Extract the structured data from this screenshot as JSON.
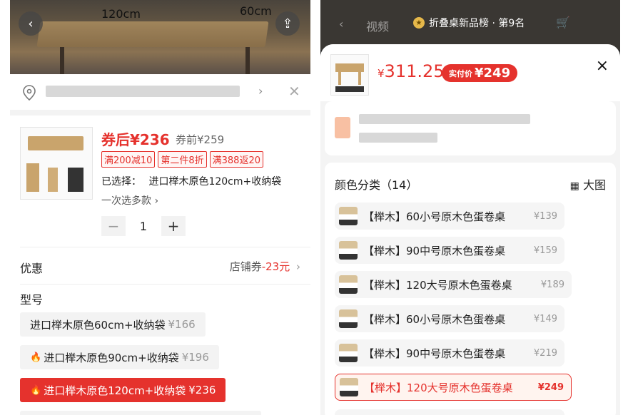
{
  "left": {
    "photo": {
      "dim_width": "120cm",
      "dim_depth": "60cm"
    },
    "price_after_coupon": "券后¥236",
    "price_before": "券前¥259",
    "tags": [
      "满200减10",
      "第二件8折",
      "满388返20"
    ],
    "selected_prefix": "已选择：",
    "selected_value": "进口榉木原色120cm+收纳袋",
    "multi_select": "一次选多款 ›",
    "quantity": "1",
    "discount_label": "优惠",
    "coupon_prefix": "店铺券",
    "coupon_amount": "-23元",
    "coupon_chevron": "›",
    "model_label": "型号",
    "options": [
      {
        "label": "进口榉木原色60cm+收纳袋",
        "price": "¥166",
        "hot": false,
        "selected": false
      },
      {
        "label": "进口榉木原色90cm+收纳袋",
        "price": "¥196",
        "hot": true,
        "selected": false
      },
      {
        "label": "进口榉木原色120cm+收纳袋",
        "price": "¥236",
        "hot": true,
        "selected": true
      }
    ]
  },
  "right": {
    "rank": "折叠桌新品榜 · 第9名",
    "header_ghost": "视频",
    "price": "311.25",
    "price_currency": "¥",
    "paid_label": "实付价",
    "paid_price": "¥249",
    "close": "×",
    "color_title": "颜色分类（14）",
    "big_image": "大图",
    "variants": [
      {
        "label": "【榉木】60小号原木色蛋卷桌",
        "price": "¥139",
        "selected": false
      },
      {
        "label": "【榉木】90中号原木色蛋卷桌",
        "price": "¥159",
        "selected": false
      },
      {
        "label": "【榉木】120大号原木色蛋卷桌",
        "price": "¥189",
        "selected": false
      },
      {
        "label": "【榉木】60小号原木色蛋卷桌",
        "price": "¥149",
        "selected": false
      },
      {
        "label": "【榉木】90中号原木色蛋卷桌",
        "price": "¥219",
        "selected": false
      },
      {
        "label": "【榉木】120大号原木色蛋卷桌",
        "price": "¥249",
        "selected": true
      }
    ]
  }
}
